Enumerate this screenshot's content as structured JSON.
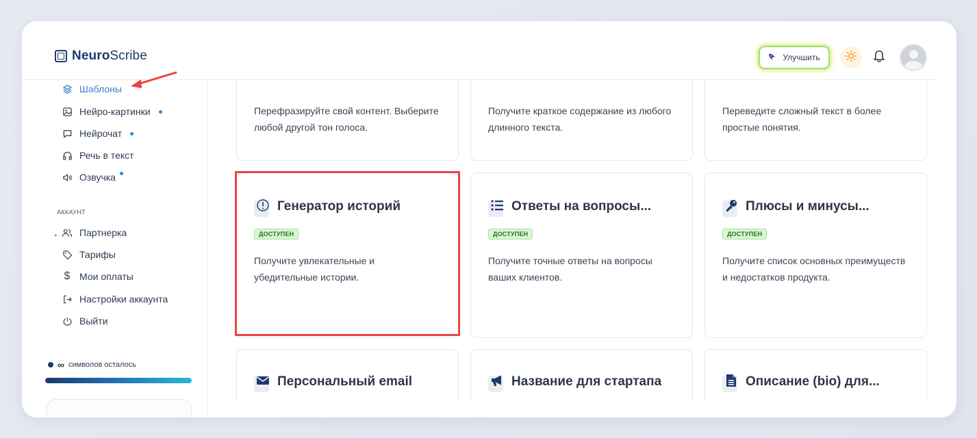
{
  "app": {
    "logo_bold": "Neuro",
    "logo_regular": "Scribe"
  },
  "header": {
    "upgrade_label": "Улучшить",
    "icons": [
      "rocket-icon",
      "sun-icon",
      "bell-icon",
      "avatar"
    ]
  },
  "sidebar": {
    "items": [
      {
        "label": "Шаблоны",
        "icon": "layers-icon",
        "active": true
      },
      {
        "label": "Нейро-картинки",
        "icon": "image-icon",
        "dot": true
      },
      {
        "label": "Нейрочат",
        "icon": "chat-icon",
        "dot": true
      },
      {
        "label": "Речь в текст",
        "icon": "headphones-icon"
      },
      {
        "label": "Озвучка",
        "icon": "speaker-icon",
        "dot": true
      }
    ],
    "account_section": "АККАУНТ",
    "account_items": [
      {
        "label": "Партнерка",
        "icon": "users-icon"
      },
      {
        "label": "Тарифы",
        "icon": "tag-icon"
      },
      {
        "label": "Мои оплаты",
        "icon": "dollar-icon"
      },
      {
        "label": "Настройки аккаунта",
        "icon": "logout-arrow-icon"
      },
      {
        "label": "Выйти",
        "icon": "power-icon"
      }
    ],
    "credits_symbol": "∞",
    "credits_text": "символов осталось"
  },
  "cards": {
    "row1": [
      {
        "desc": "Перефразируйте свой контент. Выберите любой другой тон голоса."
      },
      {
        "desc": "Получите краткое содержание из любого длинного текста."
      },
      {
        "desc": "Переведите сложный текст в более простые понятия."
      }
    ],
    "row2": [
      {
        "title": "Генератор историй",
        "badge": "ДОСТУПЕН",
        "desc": "Получите увлекательные и убедительные истории.",
        "icon": "exclamation-circle-icon"
      },
      {
        "title": "Ответы на вопросы...",
        "badge": "ДОСТУПЕН",
        "desc": "Получите точные ответы на вопросы ваших клиентов.",
        "icon": "list-icon"
      },
      {
        "title": "Плюсы и минусы...",
        "badge": "ДОСТУПЕН",
        "desc": "Получите список основных преимуществ и недостатков продукта.",
        "icon": "key-icon"
      }
    ],
    "row3": [
      {
        "title": "Персональный email",
        "icon": "envelope-icon"
      },
      {
        "title": "Название для стартапа",
        "icon": "megaphone-icon"
      },
      {
        "title": "Описание (bio) для...",
        "icon": "document-icon"
      }
    ]
  },
  "colors": {
    "brand": "#1e3a6b",
    "active": "#3d7fc8",
    "badge_bg": "#d8f7d2",
    "highlight": "#e84545"
  }
}
